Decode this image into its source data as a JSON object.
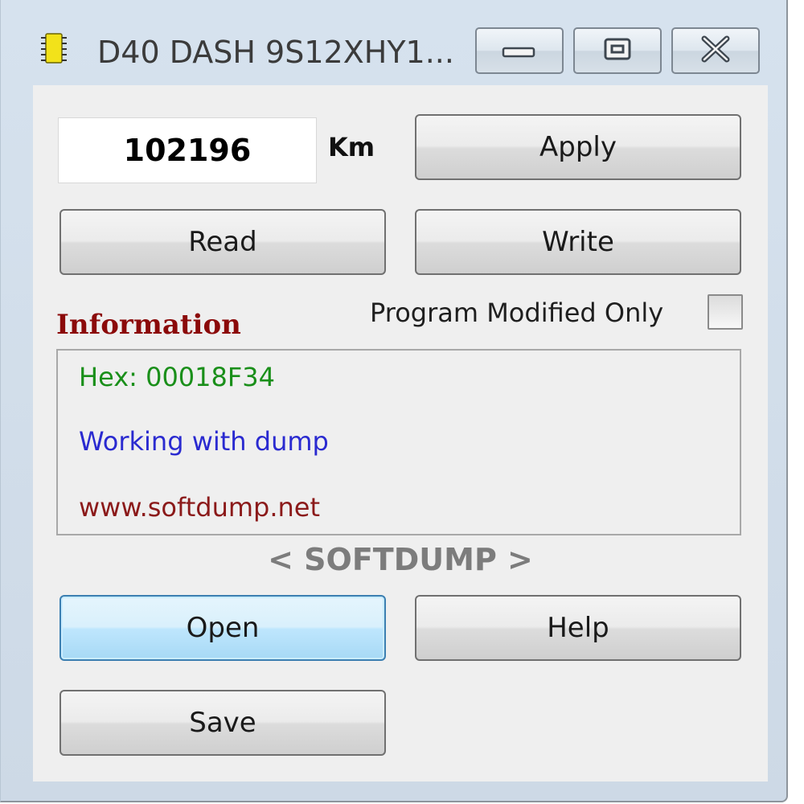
{
  "window": {
    "title": "D40 DASH 9S12XHY1...",
    "app_icon": "chip-icon",
    "caption_buttons": {
      "minimize": "minimize-icon",
      "maximize": "maximize-icon",
      "close": "close-icon"
    }
  },
  "mileage": {
    "value": "102196",
    "unit": "Km"
  },
  "buttons": {
    "apply": "Apply",
    "read": "Read",
    "write": "Write",
    "open": "Open",
    "help": "Help",
    "save": "Save"
  },
  "options": {
    "program_modified_only_label": "Program Modified Only",
    "program_modified_only_checked": false
  },
  "information": {
    "heading": "Information",
    "lines": [
      {
        "text": "Hex: 00018F34",
        "color": "#1a8f1a"
      },
      {
        "text": "Working with dump",
        "color": "#2a2ad0"
      },
      {
        "text": "www.softdump.net",
        "color": "#8b1a1a"
      }
    ]
  },
  "brand": "< SOFTDUMP >",
  "colors": {
    "info_heading": "#8b0a0a",
    "focused_button": "#bee6fd"
  }
}
